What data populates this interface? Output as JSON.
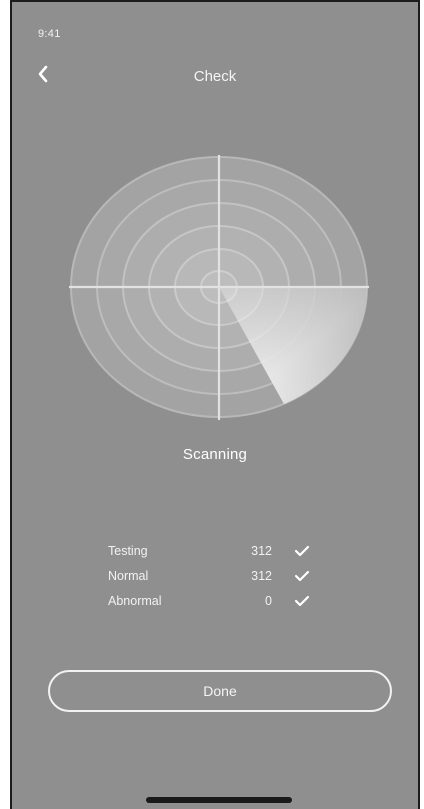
{
  "status_bar": {
    "time": "9:41"
  },
  "header": {
    "back_icon": "chevron-left-icon",
    "title": "Check"
  },
  "scanner": {
    "status": "Scanning"
  },
  "results": [
    {
      "label": "Testing",
      "value": "312",
      "icon": "check-icon"
    },
    {
      "label": "Normal",
      "value": "312",
      "icon": "check-icon"
    },
    {
      "label": "Abnormal",
      "value": "0",
      "icon": "check-icon"
    }
  ],
  "actions": {
    "done_label": "Done"
  },
  "colors": {
    "background": "#8f8f8f",
    "foreground": "#f2f2f2",
    "home_indicator": "#1a1a1a"
  }
}
